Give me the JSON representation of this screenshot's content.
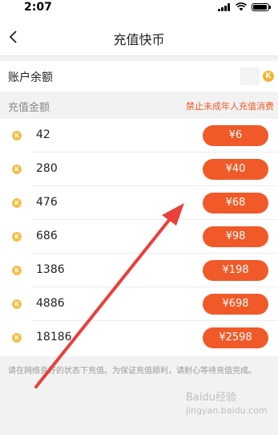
{
  "status_bar": {
    "time": "2:07"
  },
  "nav": {
    "title": "充值快币"
  },
  "balance": {
    "label": "账户余额",
    "coin_letter": "K"
  },
  "section": {
    "title": "充值金额",
    "notice": "禁止未成年人充值消费"
  },
  "recharge_options": [
    {
      "coins": "42",
      "price": "¥6"
    },
    {
      "coins": "280",
      "price": "¥40"
    },
    {
      "coins": "476",
      "price": "¥68"
    },
    {
      "coins": "686",
      "price": "¥98"
    },
    {
      "coins": "1386",
      "price": "¥198"
    },
    {
      "coins": "4886",
      "price": "¥698"
    },
    {
      "coins": "18186",
      "price": "¥2598"
    }
  ],
  "coin_letter": "K",
  "footer": {
    "note": "请在网络良好的状态下充值。为保证充值顺利，请耐心等待充值完成。"
  },
  "watermark": {
    "text": "Baidu经验",
    "url": "jingyan.baidu.com"
  },
  "colors": {
    "accent": "#f05a28",
    "coin": "#f4b535",
    "annotation": "#e8413a"
  }
}
